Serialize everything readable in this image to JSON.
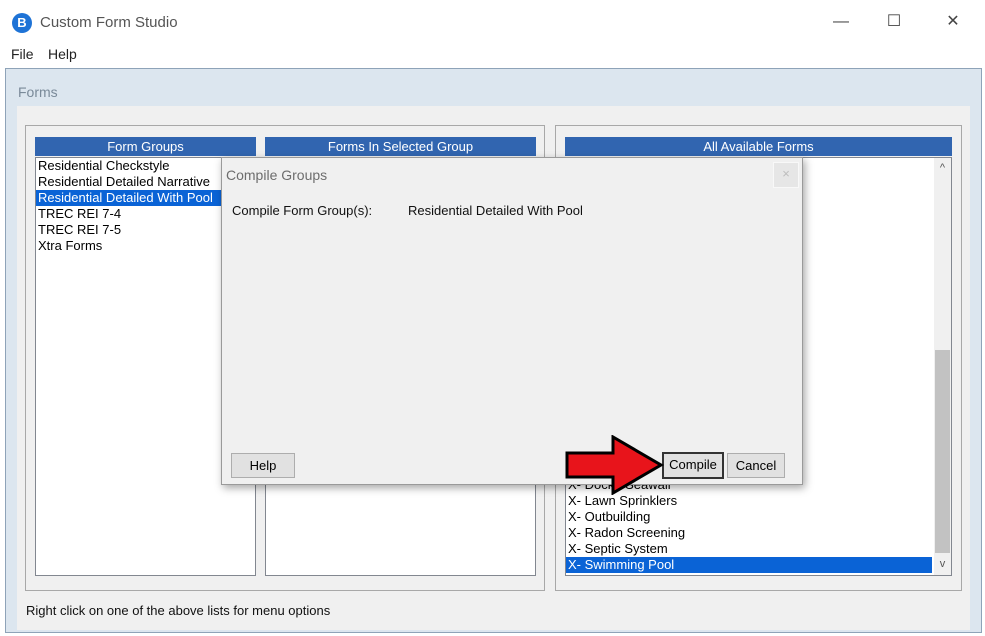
{
  "window": {
    "title": "Custom Form Studio",
    "app_icon": "B",
    "min": "—",
    "max": "☐",
    "close": "✕"
  },
  "menu": {
    "file": "File",
    "help": "Help"
  },
  "frame": {
    "title": "Forms"
  },
  "form_groups": {
    "header": "Form Groups",
    "items": [
      "Residential Checkstyle",
      "Residential Detailed Narrative",
      "Residential Detailed With Pool",
      "TREC REI 7-4",
      "TREC REI 7-5",
      "Xtra Forms"
    ],
    "selected": "Residential Detailed With Pool"
  },
  "forms_in_group": {
    "header": "Forms In Selected Group"
  },
  "all_forms": {
    "header": "All Available Forms",
    "visible_items": [
      "X- Dock / Seawall",
      "X- Lawn Sprinklers",
      "X- Outbuilding",
      "X- Radon Screening",
      "X- Septic System",
      "X- Swimming Pool"
    ],
    "selected": "X- Swimming Pool",
    "scroll_up": "^",
    "scroll_down": "v"
  },
  "status": "Right click on one of the above lists for menu options",
  "dialog": {
    "title": "Compile Groups",
    "close": "×",
    "label": "Compile Form Group(s):",
    "value": "Residential Detailed With Pool",
    "help_button": "Help",
    "compile_button": "Compile",
    "cancel_button": "Cancel"
  },
  "colors": {
    "header_blue": "#3165b0",
    "selection_blue": "#0a63d6",
    "arrow_red": "#e8141b"
  }
}
